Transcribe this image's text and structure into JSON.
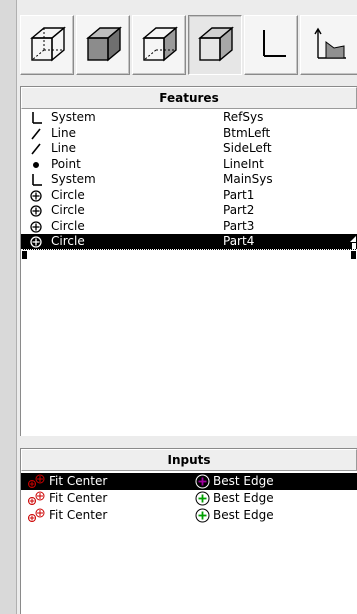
{
  "toolbar": {
    "buttons": [
      {
        "icon": "wireframe-cube-icon"
      },
      {
        "icon": "shaded-cube-icon"
      },
      {
        "icon": "hidden-line-cube-icon"
      },
      {
        "icon": "outline-cube-icon"
      },
      {
        "icon": "coordinate-system-icon"
      },
      {
        "icon": "feature-arrow-icon"
      }
    ]
  },
  "features": {
    "title": "Features",
    "items": [
      {
        "type": "System",
        "name": "RefSys",
        "icon": "system-axis-icon"
      },
      {
        "type": "Line",
        "name": "BtmLeft",
        "icon": "line-icon"
      },
      {
        "type": "Line",
        "name": "SideLeft",
        "icon": "line-icon"
      },
      {
        "type": "Point",
        "name": "LineInt",
        "icon": "point-icon"
      },
      {
        "type": "System",
        "name": "MainSys",
        "icon": "system-axis-icon"
      },
      {
        "type": "Circle",
        "name": "Part1",
        "icon": "circle-crosshair-icon"
      },
      {
        "type": "Circle",
        "name": "Part2",
        "icon": "circle-crosshair-icon"
      },
      {
        "type": "Circle",
        "name": "Part3",
        "icon": "circle-crosshair-icon"
      },
      {
        "type": "Circle",
        "name": "Part4",
        "icon": "circle-crosshair-icon",
        "selected": true
      }
    ]
  },
  "inputs": {
    "title": "Inputs",
    "items": [
      {
        "method": "Fit Center",
        "edge": "Best Edge",
        "selected": true
      },
      {
        "method": "Fit Center",
        "edge": "Best Edge"
      },
      {
        "method": "Fit Center",
        "edge": "Best Edge"
      }
    ]
  },
  "colors": {
    "selection": "#000000",
    "fit_center_icon": "#cc0000",
    "best_edge_icon": "#00a000",
    "best_edge_selected_icon": "#a000a0"
  }
}
